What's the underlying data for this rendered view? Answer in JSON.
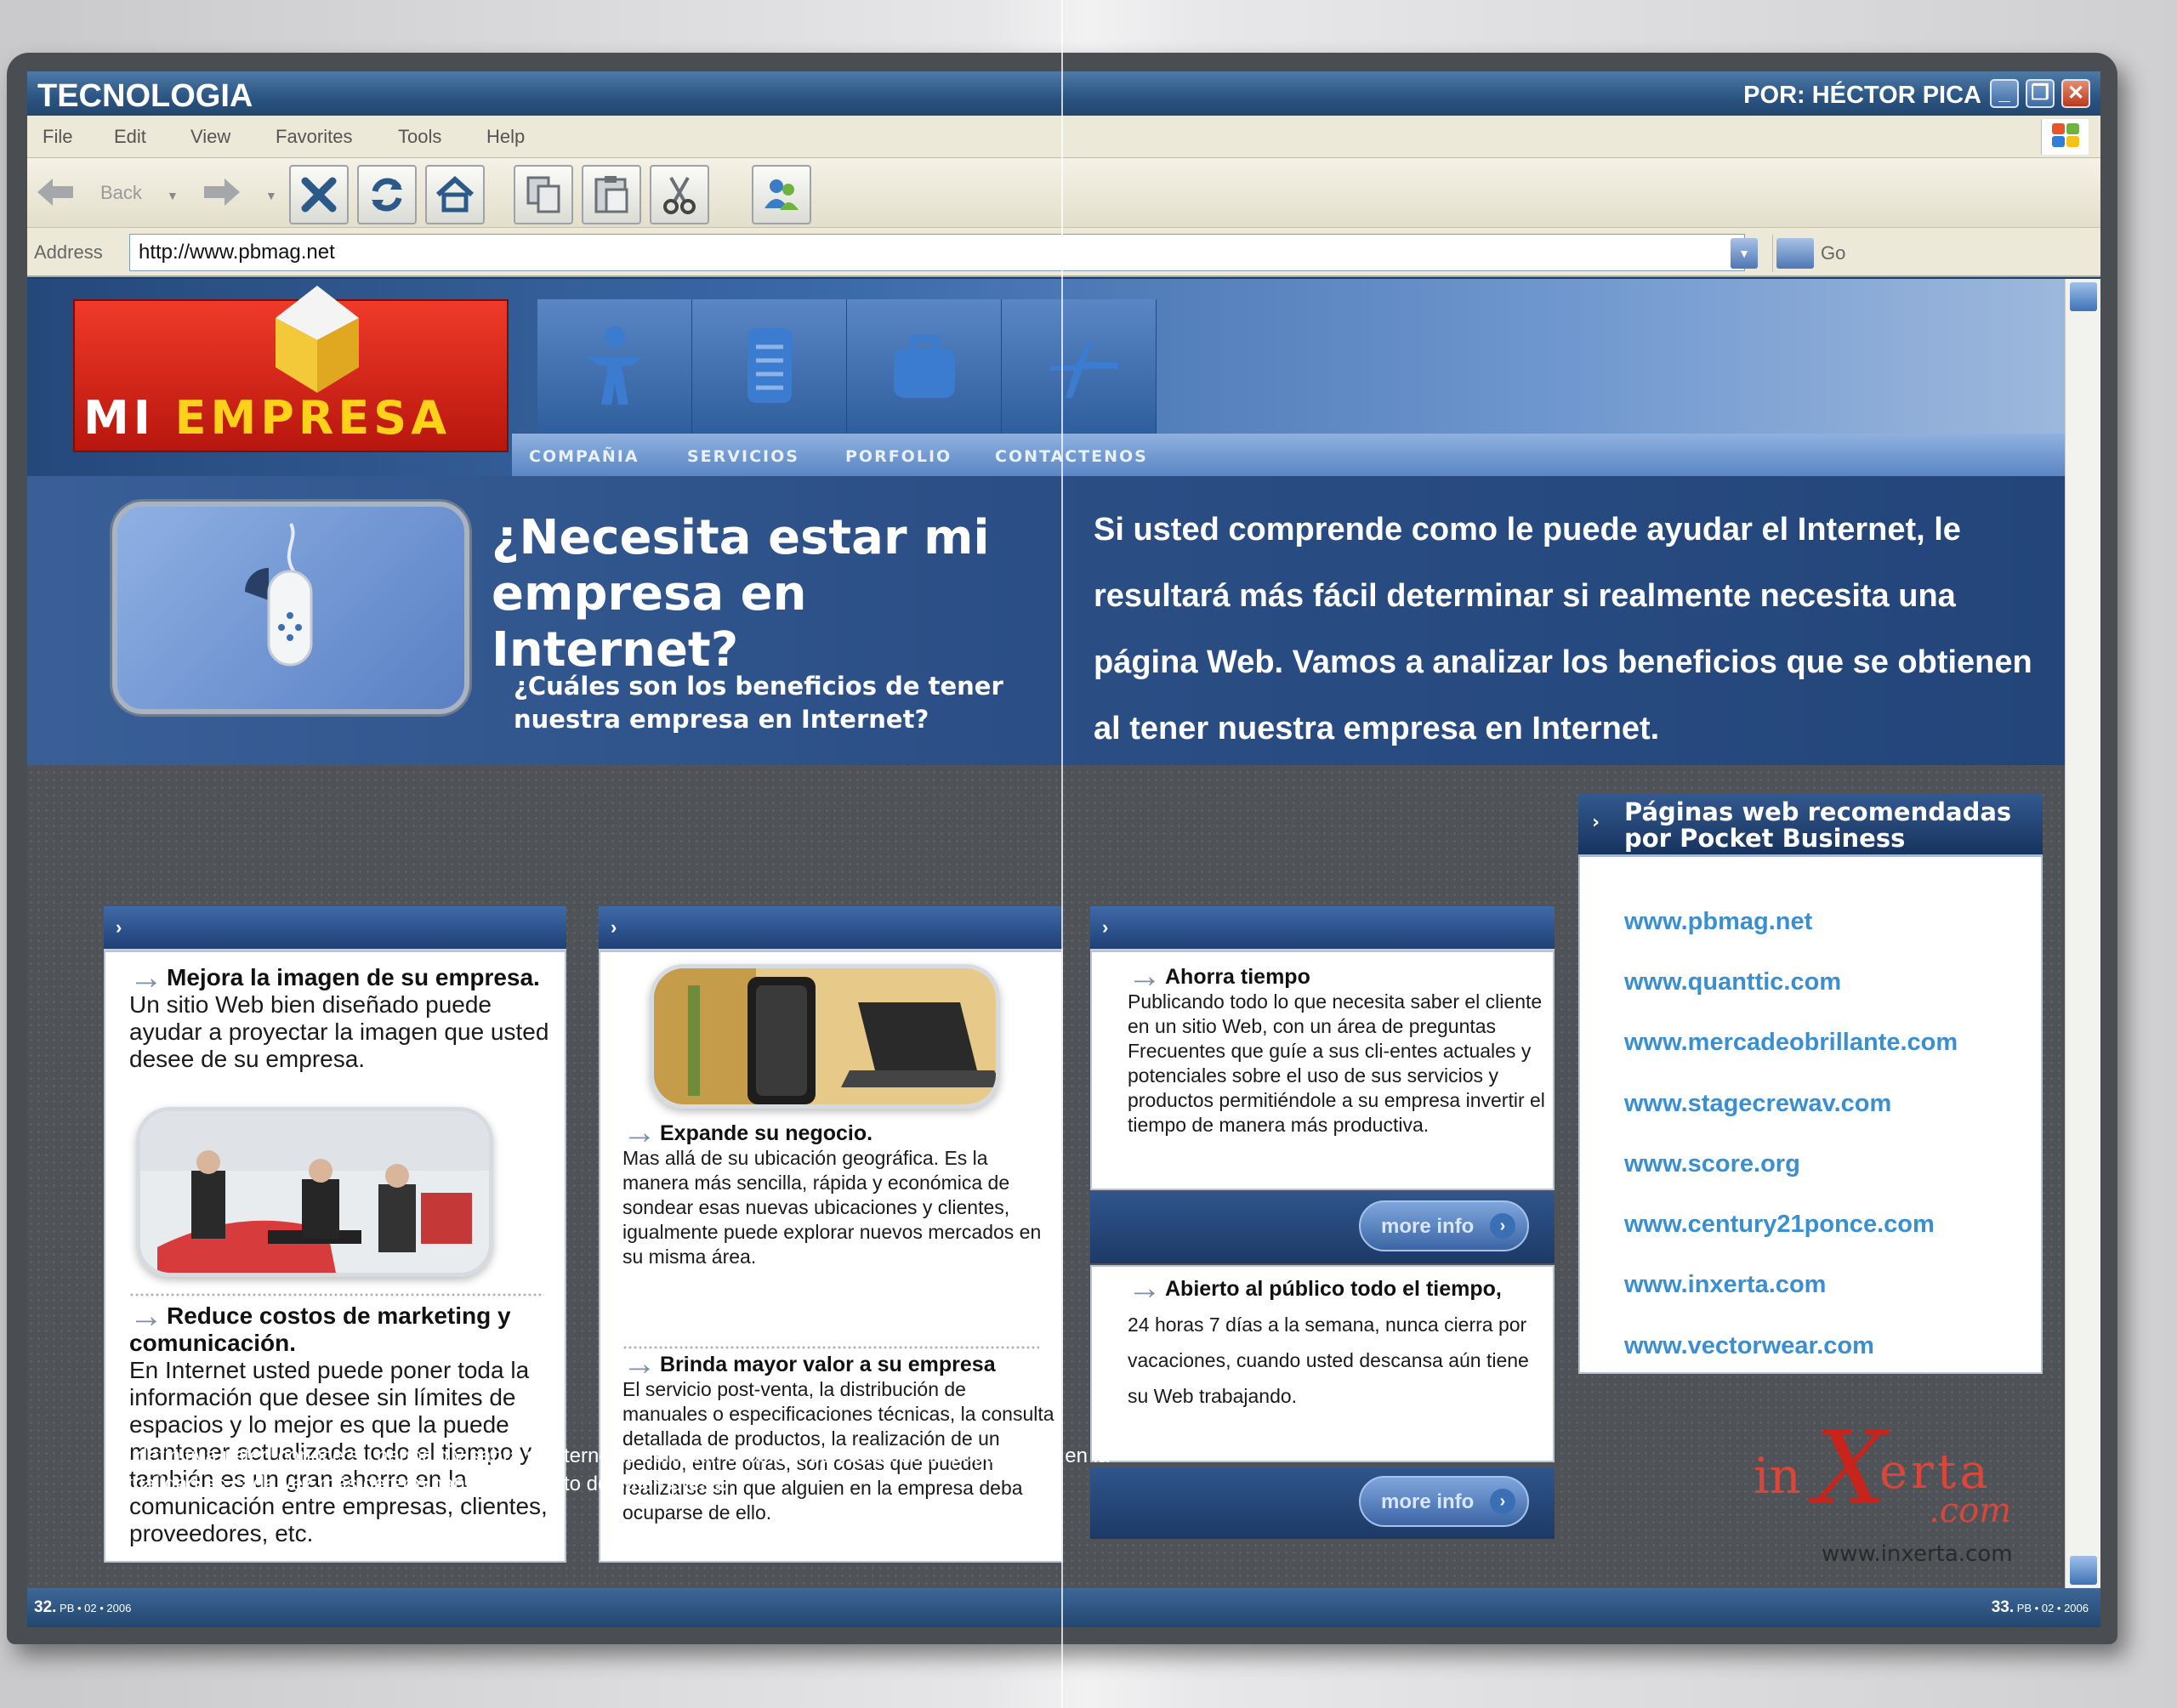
{
  "window": {
    "title": "TECNOLOGIA",
    "author": "POR: HÉCTOR PICA",
    "controls": {
      "minimize": "_",
      "maximize": "❐",
      "close": "✕"
    }
  },
  "menu": [
    "File",
    "Edit",
    "View",
    "Favorites",
    "Tools",
    "Help"
  ],
  "toolbar": {
    "back_label": "Back",
    "go_label": "Go",
    "address_label": "Address",
    "address_value": "http://www.pbmag.net",
    "buttons": [
      "stop-icon",
      "refresh-icon",
      "home-icon",
      "copy-icon",
      "paste-icon",
      "cut-icon",
      "users-icon"
    ]
  },
  "site": {
    "logo_white": "MI ",
    "logo_yellow": "EMPRESA",
    "nav": [
      "COMPAÑIA",
      "SERVICIOS",
      "PORFOLIO",
      "CONTACTENOS"
    ],
    "hero": {
      "heading": "¿Necesita estar mi empresa en Internet?",
      "subheading": "¿Cuáles son los beneficios de tener nuestra empresa en Internet?",
      "intro": "Si usted comprende como le puede ayudar el Internet, le resultará más fácil determinar si realmente necesita una página Web. Vamos a analizar los beneficios que se obtienen al tener nuestra empresa en Internet."
    },
    "col1": {
      "b1_title": "Mejora la imagen de su empresa.",
      "b1_text": "Un sitio Web bien diseñado puede ayudar a proyectar la imagen que usted desee de su empresa.",
      "b2_title": "Reduce costos de marketing y comunicación.",
      "b2_text": "En Internet usted puede poner toda la información que desee sin límites de espacios y lo mejor es que la puede mantener actualizada todo el tiempo y también es un gran ahorro en la comunicación entre empresas, clientes, proveedores, etc."
    },
    "col2": {
      "b1_title": "Expande su negocio.",
      "b1_text": "Mas allá de su ubicación geográfica. Es la manera más sencilla, rápida y económica de sondear esas nuevas ubicaciones y clientes, igualmente puede explorar nuevos mercados en su misma área.",
      "b2_title": "Brinda mayor valor a su empresa",
      "b2_text": "El servicio post-venta, la distribución de manuales o especificaciones técnicas, la consulta detallada de productos, la realización de un pedido, entre otras, son cosas que pueden realizarse sin que alguien en la empresa deba ocuparse de ello."
    },
    "col3": {
      "b1_title": "Ahorra  tiempo",
      "b1_text": "Publicando todo lo que necesita saber el cliente en un sitio Web, con un área de preguntas Frecuentes que guíe a sus cli-entes actuales y potenciales sobre el uso de sus servicios y productos permitiéndole a su empresa invertir el tiempo de manera más productiva.",
      "b2_title": "Abierto al público todo el tiempo,",
      "b2_text": "24 horas 7 días a la semana, nunca cierra por vacaciones, cuando usted descansa aún tiene su Web trabajando.",
      "more_info": "more info"
    },
    "links": {
      "title": "Páginas  web recomendadas por Pocket Business",
      "items": [
        "www.pbmag.net",
        "www.quanttic.com",
        "www.mercadeobrillante.com",
        "www.stagecrewav.com",
        "www.score.org",
        "www.century21ponce.com",
        "www.inxerta.com",
        "www.vectorwear.com"
      ]
    },
    "footer_note": "En definitiva usted conoce su negocio y sabrá si Internet le será útil, el contar con una buena página Web en la actualidad es cada vez más determinante en el éxito de su empresa.",
    "brand": {
      "in": "in",
      "x": "X",
      "erta": "erta",
      "com": ".com",
      "url": "www.inxerta.com"
    }
  },
  "status": {
    "left_page": "32.",
    "left_meta": " PB • 02 • 2006",
    "right_page": "33.",
    "right_meta": " PB • 02 • 2006"
  },
  "colors": {
    "accent": "#2a5482",
    "link": "#3a8fd1",
    "logo_red": "#e02a1c",
    "logo_yellow": "#ffd21a"
  }
}
